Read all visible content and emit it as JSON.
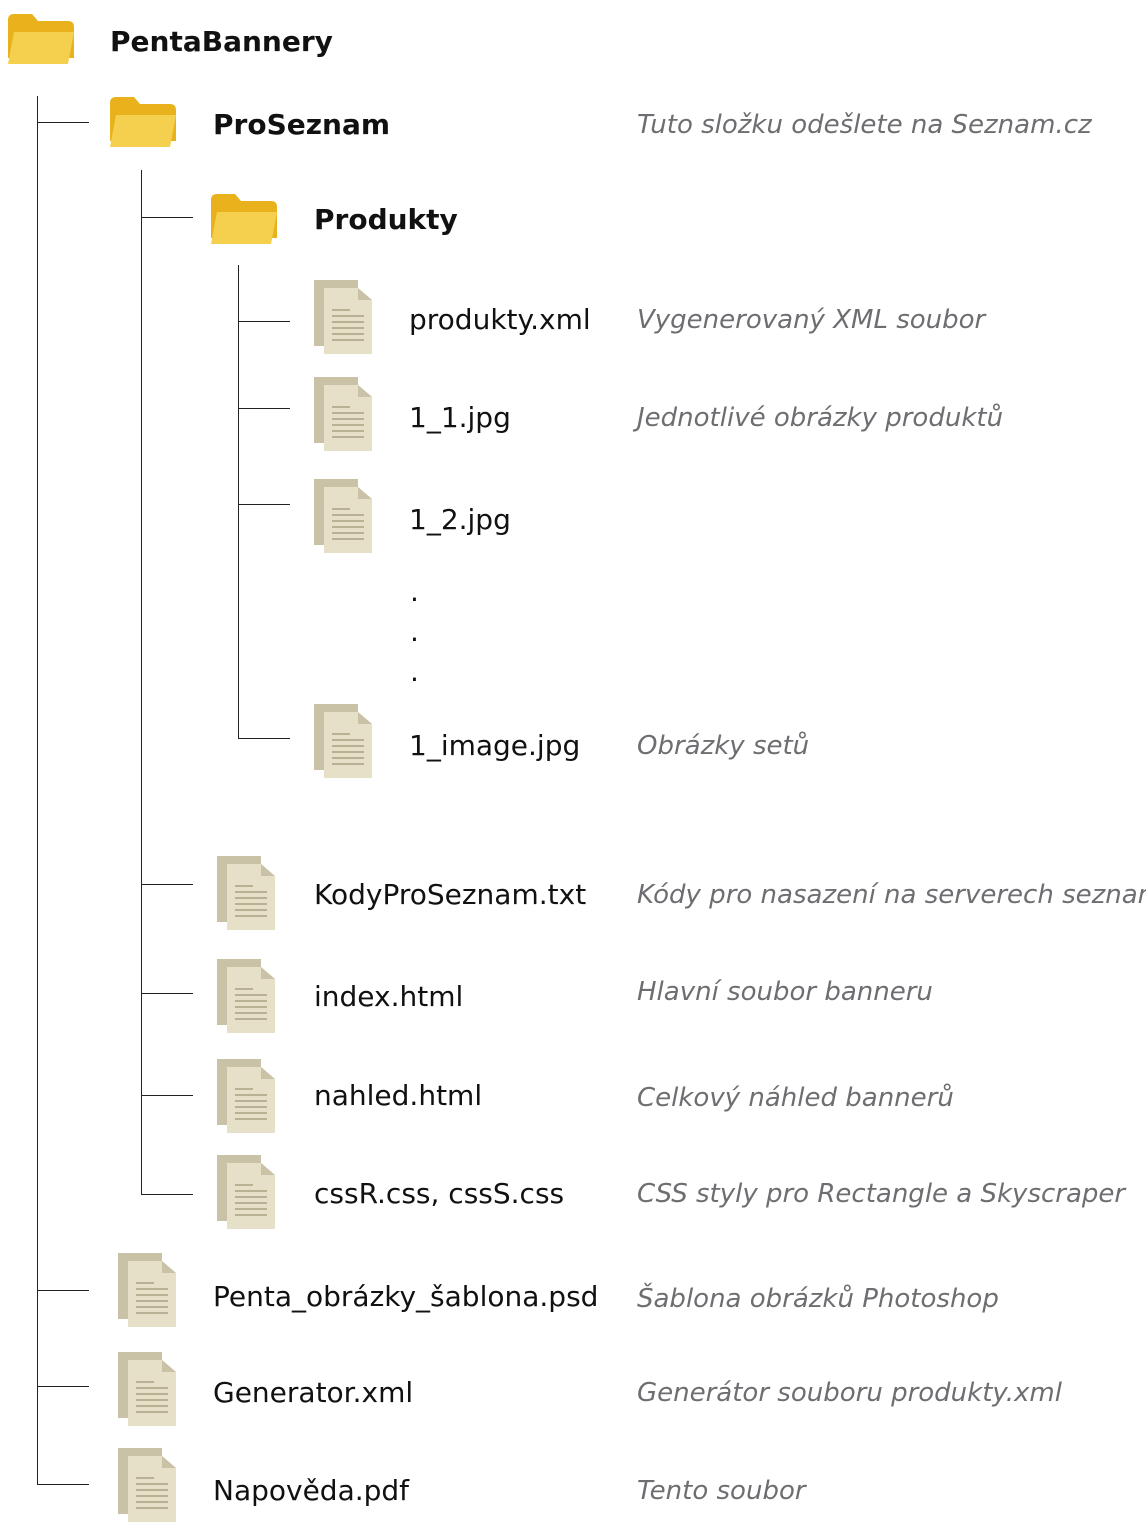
{
  "root": {
    "name": "PentaBannery",
    "icon": "folder-icon"
  },
  "proseznam": {
    "name": "ProSeznam",
    "note": "Tuto složku odešlete na Seznam.cz",
    "icon": "folder-icon"
  },
  "produkty": {
    "name": "Produkty",
    "icon": "folder-icon",
    "files": [
      {
        "name": "produkty.xml",
        "note": "Vygenerovaný XML soubor",
        "icon": "document-icon"
      },
      {
        "name": "1_1.jpg",
        "note": "Jednotlivé obrázky produktů",
        "icon": "document-icon"
      },
      {
        "name": "1_2.jpg",
        "note": "",
        "icon": "document-icon"
      },
      {
        "name": "1_image.jpg",
        "note": "Obrázky setů",
        "icon": "document-icon"
      }
    ],
    "ellipsis": [
      ".",
      ".",
      "."
    ]
  },
  "proseznam_files": [
    {
      "name": "KodyProSeznam.txt",
      "note": "Kódy pro nasazení na serverech seznam",
      "icon": "document-icon"
    },
    {
      "name": "index.html",
      "note": "Hlavní soubor banneru",
      "icon": "document-icon"
    },
    {
      "name": "nahled.html",
      "note": "Celkový náhled bannerů",
      "icon": "document-icon"
    },
    {
      "name": "cssR.css, cssS.css",
      "note": "CSS styly pro Rectangle a Skyscraper",
      "icon": "document-icon"
    }
  ],
  "root_files": [
    {
      "name": "Penta_obrázky_šablona.psd",
      "note": "Šablona obrázků Photoshop",
      "icon": "document-icon"
    },
    {
      "name": "Generator.xml",
      "note": "Generátor souboru produkty.xml",
      "icon": "document-icon"
    },
    {
      "name": "Napověda.pdf",
      "note": "Tento soubor",
      "icon": "document-icon"
    }
  ],
  "colors": {
    "folder_back": "#e9b21d",
    "folder_front": "#f5d04e",
    "doc_back": "#c9c2a6",
    "doc_front": "#e6e0c9",
    "doc_lines": "#b9b193",
    "note_text": "#6d6e71",
    "line": "#222222"
  }
}
